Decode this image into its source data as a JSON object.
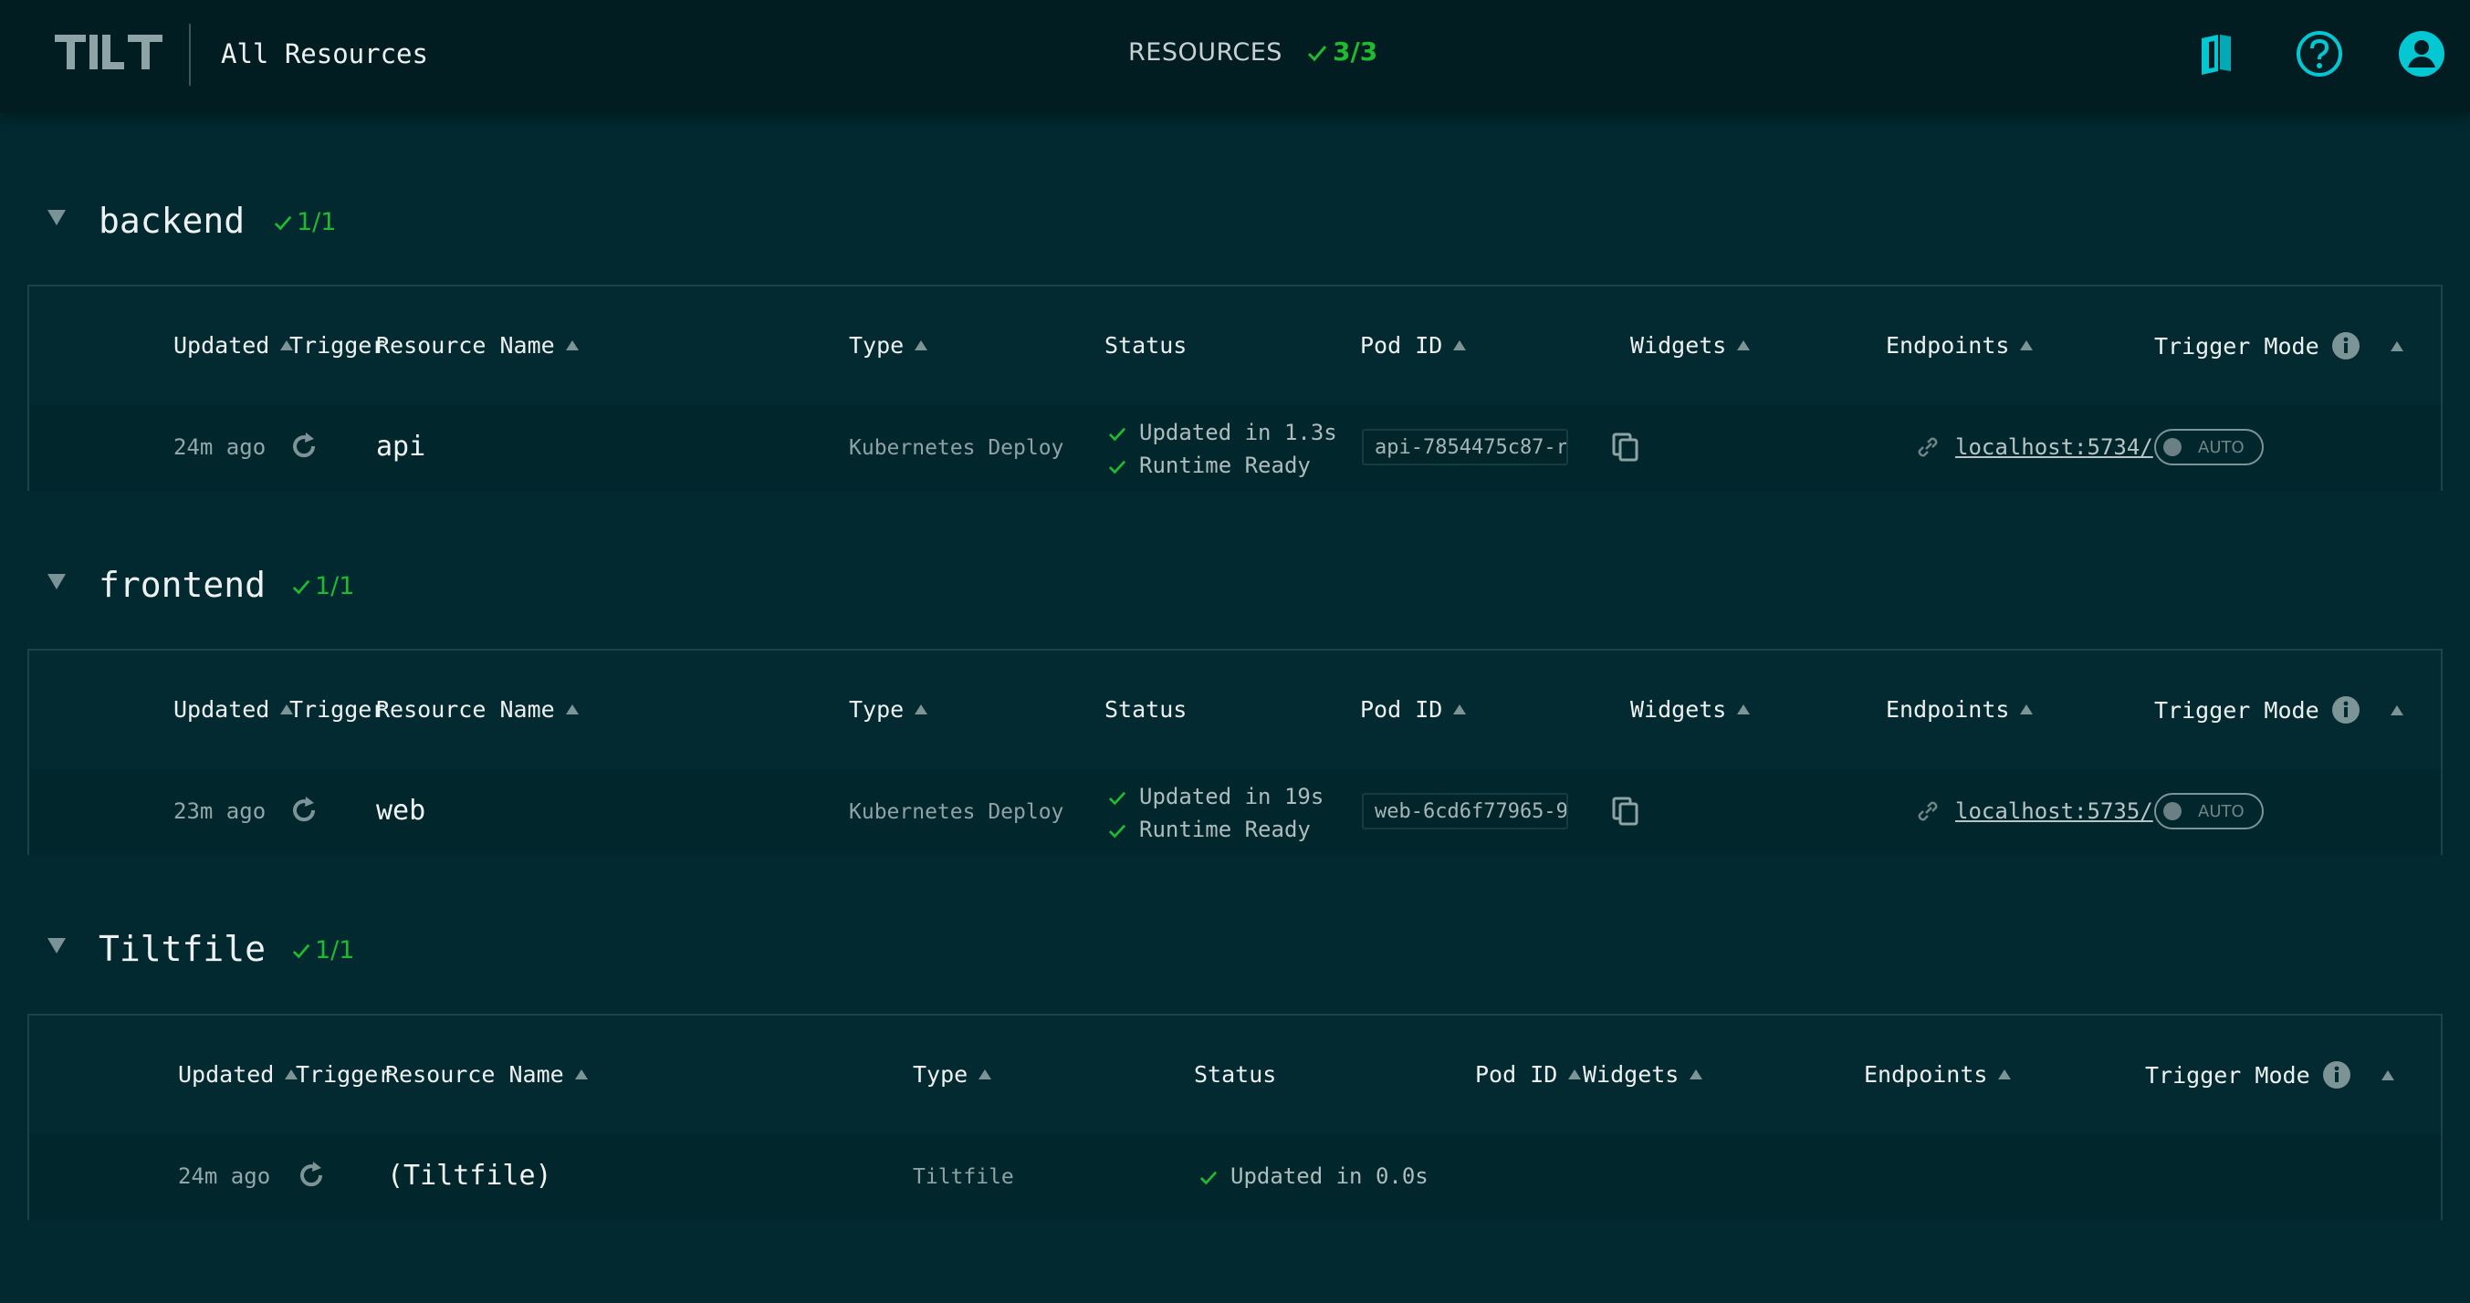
{
  "header": {
    "logo_text": "TILT",
    "title": "All Resources",
    "resources_label": "RESOURCES",
    "resources_count": "3/3",
    "icons": [
      "book-icon",
      "help-icon",
      "account-icon"
    ]
  },
  "colors": {
    "ok": "#20ba31",
    "accent": "#03c7d3",
    "background": "#01292f"
  },
  "columns": {
    "updated": "Updated",
    "trigger": "Trigger",
    "resource_name": "Resource Name",
    "type": "Type",
    "status": "Status",
    "pod_id": "Pod ID",
    "widgets": "Widgets",
    "endpoints": "Endpoints",
    "trigger_mode": "Trigger Mode"
  },
  "groups": [
    {
      "name": "backend",
      "count": "1/1",
      "resource": {
        "updated": "24m ago",
        "name": "api",
        "type": "Kubernetes Deploy",
        "status": [
          "Updated in 1.3s",
          "Runtime Ready"
        ],
        "pod_id": "api-7854475c87-r",
        "endpoint": "localhost:5734/",
        "trigger_mode": "AUTO"
      }
    },
    {
      "name": "frontend",
      "count": "1/1",
      "resource": {
        "updated": "23m ago",
        "name": "web",
        "type": "Kubernetes Deploy",
        "status": [
          "Updated in 19s",
          "Runtime Ready"
        ],
        "pod_id": "web-6cd6f77965-9",
        "endpoint": "localhost:5735/",
        "trigger_mode": "AUTO"
      }
    },
    {
      "name": "Tiltfile",
      "count": "1/1",
      "resource": {
        "updated": "24m ago",
        "name": "(Tiltfile)",
        "type": "Tiltfile",
        "status": [
          "Updated in 0.0s"
        ]
      }
    }
  ]
}
